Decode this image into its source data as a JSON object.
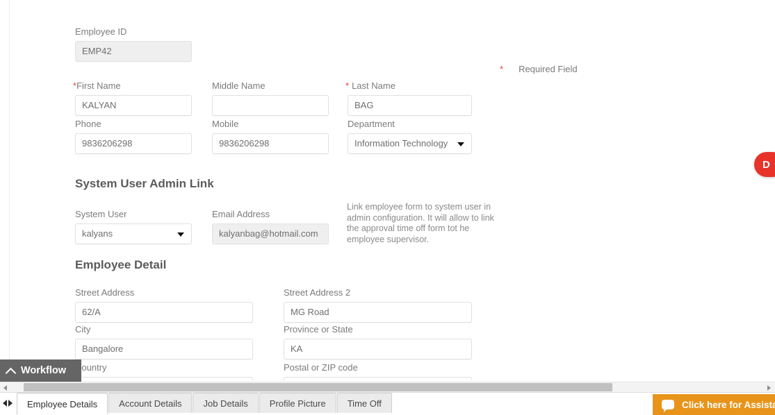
{
  "form": {
    "required_note": {
      "star": "*",
      "label": "Required Field"
    },
    "employee_id": {
      "label": "Employee ID",
      "value": "EMP42"
    },
    "first_name": {
      "star": "*",
      "label": "First Name",
      "value": "KALYAN"
    },
    "middle_name": {
      "label": "Middle Name",
      "value": ""
    },
    "last_name": {
      "star": "*",
      "label": "Last Name",
      "value": "BAG"
    },
    "phone": {
      "label": "Phone",
      "value": "9836206298"
    },
    "mobile": {
      "label": "Mobile",
      "value": "9836206298"
    },
    "department": {
      "label": "Department",
      "value": "Information Technology"
    }
  },
  "system_user_section": {
    "title": "System User Admin Link",
    "system_user": {
      "label": "System User",
      "value": "kalyans"
    },
    "email_address": {
      "label": "Email Address",
      "value": "kalyanbag@hotmail.com"
    },
    "help_text": "Link employee form to system user in admin configuration. It will allow to link the approval time off form tot he employee supervisor."
  },
  "employee_detail_section": {
    "title": "Employee Detail",
    "street_address": {
      "label": "Street Address",
      "value": "62/A"
    },
    "street_address_2": {
      "label": "Street Address 2",
      "value": "MG Road"
    },
    "city": {
      "label": "City",
      "value": "Bangalore"
    },
    "province_or_state": {
      "label": "Province or State",
      "value": "KA"
    },
    "country": {
      "label": "Country",
      "value": ""
    },
    "postal_or_zip": {
      "label": "Postal or ZIP code",
      "value": ""
    }
  },
  "workflow": {
    "label": "Workflow"
  },
  "tabs": [
    {
      "label": "Employee Details",
      "active": true
    },
    {
      "label": "Account Details",
      "active": false
    },
    {
      "label": "Job Details",
      "active": false
    },
    {
      "label": "Profile Picture",
      "active": false
    },
    {
      "label": "Time Off",
      "active": false
    }
  ],
  "chat_widget": {
    "label": "Click here for Assistance",
    "close": "×",
    "color": "#e8941a"
  },
  "right_tab": {
    "label": "D",
    "color": "#e8322a"
  },
  "colors": {
    "required_star": "#e8413c",
    "label_text": "#7b7b7b",
    "section_title": "#5b5b5b",
    "input_border": "#e0e0e2",
    "disabled_input_bg": "#efeff0",
    "workflow_bar": "#656565"
  }
}
